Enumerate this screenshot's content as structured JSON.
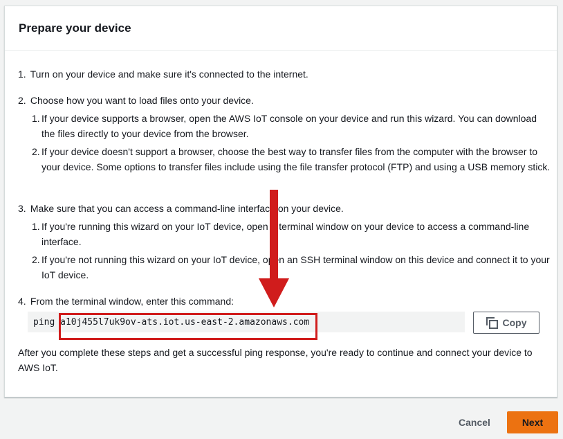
{
  "panel": {
    "title": "Prepare your device"
  },
  "steps": [
    {
      "num": "1.",
      "text": "Turn on your device and make sure it's connected to the internet."
    },
    {
      "num": "2.",
      "text": "Choose how you want to load files onto your device.",
      "sub": [
        {
          "num": "1.",
          "text": "If your device supports a browser, open the AWS IoT console on your device and run this wizard. You can download the files directly to your device from the browser."
        },
        {
          "num": "2.",
          "text": "If your device doesn't support a browser, choose the best way to transfer files from the computer with the browser to your device. Some options to transfer files include using the file transfer protocol (FTP) and using a USB memory stick."
        }
      ]
    },
    {
      "num": "3.",
      "text": "Make sure that you can access a command-line interface on your device.",
      "sub": [
        {
          "num": "1.",
          "text": "If you're running this wizard on your IoT device, open a terminal window on your device to access a command-line interface."
        },
        {
          "num": "2.",
          "text": "If you're not running this wizard on your IoT device, open an SSH terminal window on this device and connect it to your IoT device."
        }
      ]
    },
    {
      "num": "4.",
      "text": "From the terminal window, enter this command:"
    }
  ],
  "command": {
    "prefix": "ping",
    "host": "a10j455l7uk9ov-ats.iot.us-east-2.amazonaws.com"
  },
  "copy_button": {
    "label": "Copy",
    "icon": "copy-icon"
  },
  "after_text": "After you complete these steps and get a successful ping response, you're ready to continue and connect your device to AWS IoT.",
  "footer": {
    "cancel_label": "Cancel",
    "next_label": "Next"
  },
  "colors": {
    "accent": "#ec7211",
    "annotation": "#d01c1c"
  }
}
